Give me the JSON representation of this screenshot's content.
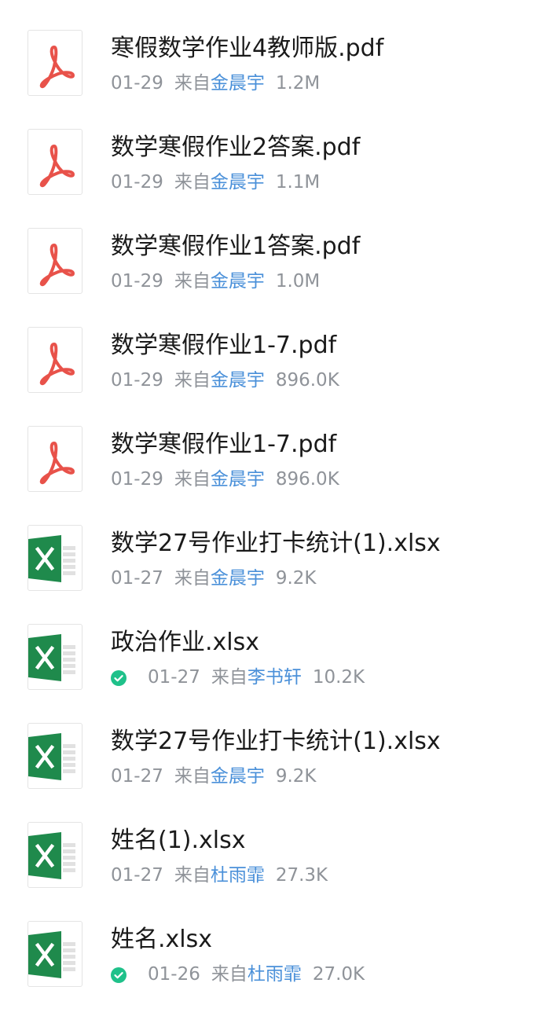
{
  "files": [
    {
      "type": "pdf",
      "name": "寒假数学作业4教师版.pdf",
      "date": "01-29",
      "from_label": "来自",
      "sender": "金晨宇",
      "size": "1.2M",
      "synced": false
    },
    {
      "type": "pdf",
      "name": "数学寒假作业2答案.pdf",
      "date": "01-29",
      "from_label": "来自",
      "sender": "金晨宇",
      "size": "1.1M",
      "synced": false
    },
    {
      "type": "pdf",
      "name": "数学寒假作业1答案.pdf",
      "date": "01-29",
      "from_label": "来自",
      "sender": "金晨宇",
      "size": "1.0M",
      "synced": false
    },
    {
      "type": "pdf",
      "name": "数学寒假作业1-7.pdf",
      "date": "01-29",
      "from_label": "来自",
      "sender": "金晨宇",
      "size": "896.0K",
      "synced": false
    },
    {
      "type": "pdf",
      "name": "数学寒假作业1-7.pdf",
      "date": "01-29",
      "from_label": "来自",
      "sender": "金晨宇",
      "size": "896.0K",
      "synced": false
    },
    {
      "type": "xlsx",
      "name": "数学27号作业打卡统计(1).xlsx",
      "date": "01-27",
      "from_label": "来自",
      "sender": "金晨宇",
      "size": "9.2K",
      "synced": false
    },
    {
      "type": "xlsx",
      "name": "政治作业.xlsx",
      "date": "01-27",
      "from_label": "来自",
      "sender": "李书轩",
      "size": "10.2K",
      "synced": true
    },
    {
      "type": "xlsx",
      "name": "数学27号作业打卡统计(1).xlsx",
      "date": "01-27",
      "from_label": "来自",
      "sender": "金晨宇",
      "size": "9.2K",
      "synced": false
    },
    {
      "type": "xlsx",
      "name": "姓名(1).xlsx",
      "date": "01-27",
      "from_label": "来自",
      "sender": "杜雨霏",
      "size": "27.3K",
      "synced": false
    },
    {
      "type": "xlsx",
      "name": "姓名.xlsx",
      "date": "01-26",
      "from_label": "来自",
      "sender": "杜雨霏",
      "size": "27.0K",
      "synced": true
    }
  ],
  "colors": {
    "pdf_icon": "#e8524a",
    "excel_icon": "#1f8a4c",
    "sender_link": "#4a90d9",
    "sync_check": "#1fc18a"
  }
}
